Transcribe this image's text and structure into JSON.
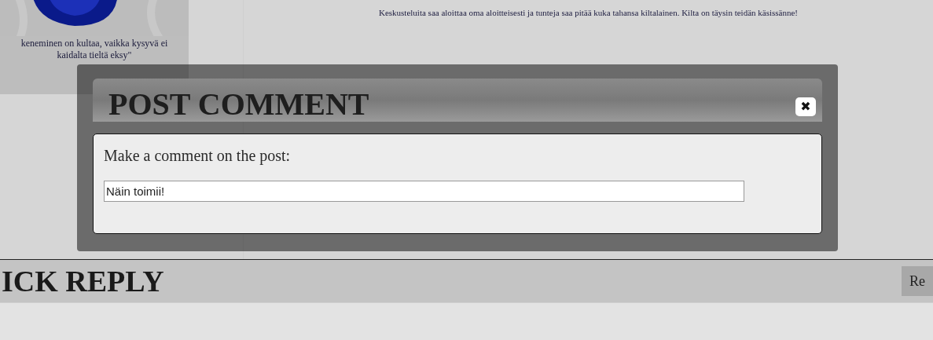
{
  "sidebar": {
    "quote": [
      "keneminen on kultaa, vaikka kysyvä ei",
      "kaidalta tieltä eksy\""
    ]
  },
  "intro": "Keskusteluita saa aloittaa oma aloitteisesti ja tunteja saa pitää kuka tahansa kiltalainen. Kilta on täysin teidän käsissänne!",
  "quick_reply": {
    "title": "ICK REPLY",
    "button": "Re"
  },
  "dialog": {
    "title": "POST COMMENT",
    "close": "✖",
    "label": "Make a comment on the post:",
    "comment_field": {
      "value": "Näin toimii!"
    }
  }
}
